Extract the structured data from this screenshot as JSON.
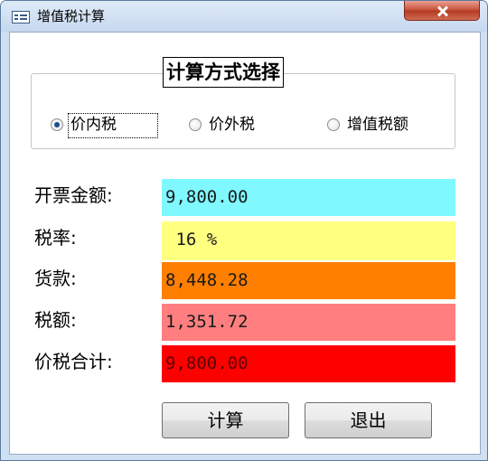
{
  "window": {
    "title": "增值税计算",
    "icon": "form-icon"
  },
  "option_group": {
    "title": "计算方式选择",
    "options": [
      {
        "label": "价内税",
        "checked": true
      },
      {
        "label": "价外税",
        "checked": false
      },
      {
        "label": "增值税额",
        "checked": false
      }
    ]
  },
  "fields": {
    "amount": {
      "label": "开票金额:",
      "value": "9,800.00",
      "color": "#7ff9ff"
    },
    "rate": {
      "label": "税率:",
      "value": " 16 %",
      "color": "#ffff80"
    },
    "goods": {
      "label": "货款:",
      "value": "8,448.28",
      "color": "#ff7f00"
    },
    "tax": {
      "label": "税额:",
      "value": "1,351.72",
      "color": "#ff7f80"
    },
    "total": {
      "label": "价税合计:",
      "value": "9,800.00",
      "color": "#ff0000"
    }
  },
  "buttons": {
    "calculate": "计算",
    "exit": "退出"
  }
}
